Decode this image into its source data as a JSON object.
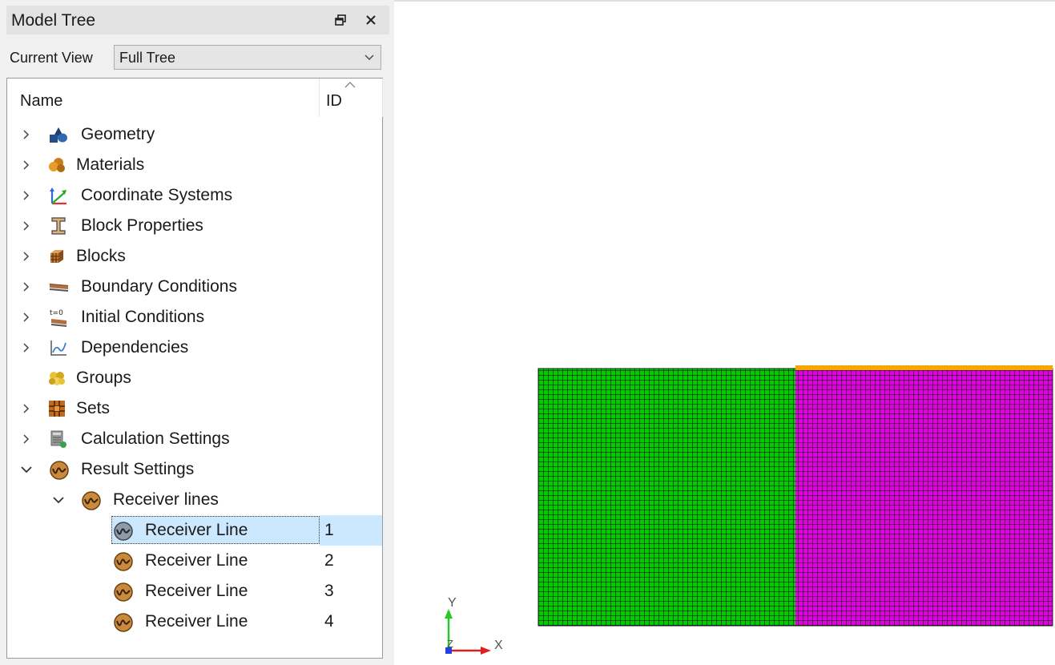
{
  "panel": {
    "title": "Model Tree",
    "float_icon": "restore-window-icon",
    "close_icon": "close-icon",
    "current_view_label": "Current View",
    "current_view_value": "Full Tree",
    "columns": {
      "name": "Name",
      "id": "ID"
    }
  },
  "tree": {
    "items": [
      {
        "label": "Geometry",
        "icon": "geometry-icon",
        "expander": "collapsed"
      },
      {
        "label": "Materials",
        "icon": "materials-icon",
        "expander": "collapsed"
      },
      {
        "label": "Coordinate Systems",
        "icon": "coordinate-systems-icon",
        "expander": "collapsed"
      },
      {
        "label": "Block Properties",
        "icon": "block-properties-icon",
        "expander": "collapsed"
      },
      {
        "label": "Blocks",
        "icon": "blocks-icon",
        "expander": "collapsed"
      },
      {
        "label": "Boundary Conditions",
        "icon": "boundary-conditions-icon",
        "expander": "collapsed"
      },
      {
        "label": "Initial Conditions",
        "icon": "initial-conditions-icon",
        "expander": "collapsed"
      },
      {
        "label": "Dependencies",
        "icon": "dependencies-icon",
        "expander": "collapsed"
      },
      {
        "label": "Groups",
        "icon": "groups-icon",
        "expander": "none"
      },
      {
        "label": "Sets",
        "icon": "sets-icon",
        "expander": "collapsed"
      },
      {
        "label": "Calculation Settings",
        "icon": "calculation-settings-icon",
        "expander": "collapsed"
      },
      {
        "label": "Result Settings",
        "icon": "result-settings-icon",
        "expander": "expanded"
      },
      {
        "label": "Receiver lines",
        "icon": "receiver-lines-icon",
        "expander": "expanded"
      },
      {
        "label": "Receiver Line",
        "id": "1",
        "icon": "receiver-line-icon",
        "selected": true
      },
      {
        "label": "Receiver Line",
        "id": "2",
        "icon": "receiver-line-icon"
      },
      {
        "label": "Receiver Line",
        "id": "3",
        "icon": "receiver-line-icon"
      },
      {
        "label": "Receiver Line",
        "id": "4",
        "icon": "receiver-line-icon"
      }
    ]
  },
  "viewport": {
    "axes": {
      "x": "X",
      "y": "Y",
      "z": "Z"
    },
    "colors": {
      "left_block": "#00cc00",
      "right_block": "#e000e0",
      "receiver_line": "#f5a800",
      "mesh_lines": "#1a1a1a"
    }
  }
}
